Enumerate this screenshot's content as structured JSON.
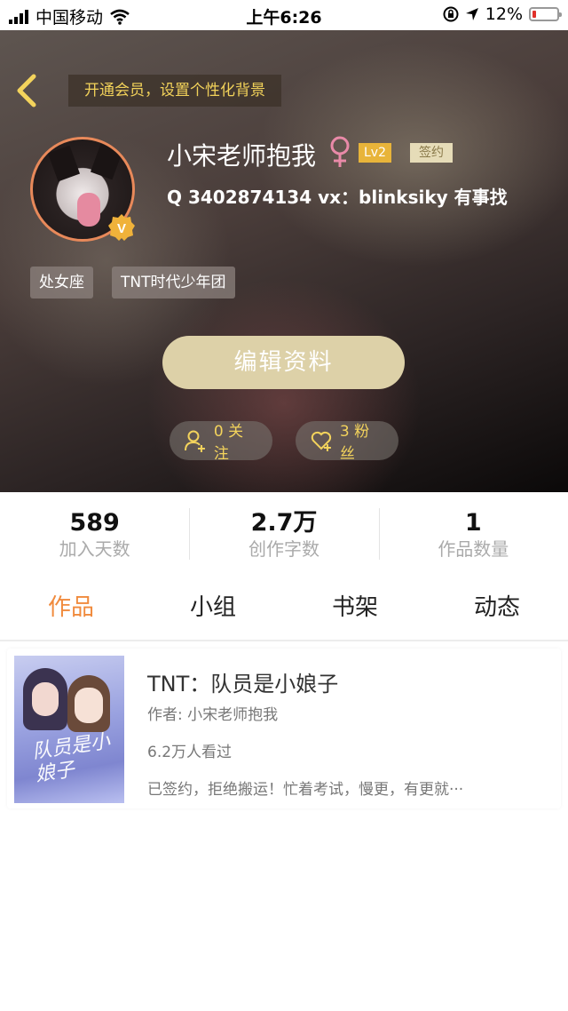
{
  "status_bar": {
    "carrier": "中国移动",
    "time": "上午6:26",
    "battery": "12%",
    "icons": [
      "signal-icon",
      "wifi-icon",
      "rotation-lock-icon",
      "location-arrow-icon",
      "battery-icon"
    ]
  },
  "header": {
    "back_icon": "chevron-left-icon",
    "vip_banner": "开通会员，设置个性化背景",
    "username": "小宋老师抱我",
    "gender_icon": "female-icon",
    "level_badge": "Lv2",
    "sign_badge": "签约",
    "bio": "Q 3402874134 vx：blinksiky 有事找",
    "verified_badge": "V",
    "tags": [
      "处女座",
      "TNT时代少年团"
    ],
    "edit_button": "编辑资料",
    "follow": {
      "count": "0",
      "label": "关注",
      "display": "0 关注"
    },
    "fans": {
      "count": "3",
      "label": "粉丝",
      "display": "3 粉丝"
    },
    "colors": {
      "accent_gold": "#f3d35c",
      "edit_button_bg": "#ddd1a8",
      "level_badge_bg": "#e8b43a"
    }
  },
  "stats": [
    {
      "value": "589",
      "label": "加入天数"
    },
    {
      "value": "2.7万",
      "label": "创作字数"
    },
    {
      "value": "1",
      "label": "作品数量"
    }
  ],
  "tabs": [
    {
      "label": "作品",
      "active": true
    },
    {
      "label": "小组",
      "active": false
    },
    {
      "label": "书架",
      "active": false
    },
    {
      "label": "动态",
      "active": false
    }
  ],
  "tab_active_color": "#f08a3c",
  "works": [
    {
      "title": "TNT：队员是小娘子",
      "author": "作者: 小宋老师抱我",
      "views": "6.2万人看过",
      "description": "已签约，拒绝搬运！忙着考试，慢更，有更就···",
      "cover_text": "队员是小娘子"
    }
  ]
}
